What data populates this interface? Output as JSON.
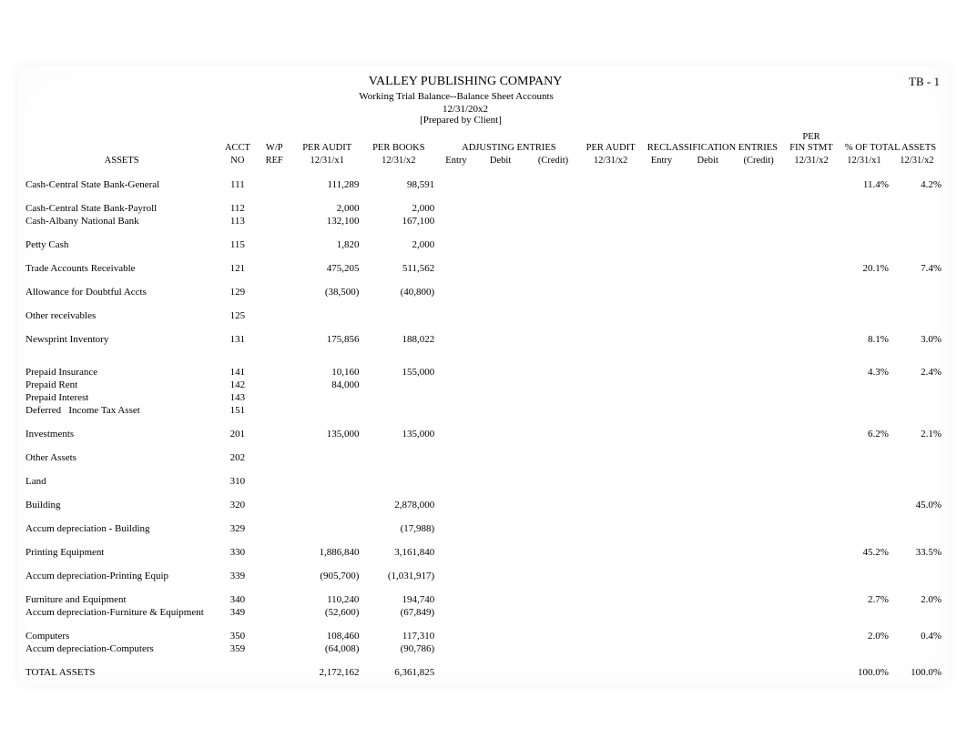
{
  "header": {
    "company": "VALLEY PUBLISHING COMPANY",
    "subtitle": "Working Trial Balance--Balance Sheet Accounts",
    "date": "12/31/20x2",
    "prepared": "[Prepared by Client]",
    "tb": "TB - 1"
  },
  "columns": {
    "assets": "ASSETS",
    "acct_top": "ACCT",
    "acct_bot": "NO",
    "wp_top": "W/P",
    "wp_bot": "REF",
    "pa1_top": "PER AUDIT",
    "pa1_bot": "12/31/x1",
    "pbk_top": "PER BOOKS",
    "pbk_bot": "12/31/x2",
    "adj_top": "ADJUSTING ENTRIES",
    "adj_entry": "Entry",
    "adj_debit": "Debit",
    "adj_credit": "(Credit)",
    "pa2_top": "PER AUDIT",
    "pa2_bot": "12/31/x2",
    "recl_top": "RECLASSIFICATION ENTRIES",
    "recl_entry": "Entry",
    "recl_debit": "Debit",
    "recl_credit": "(Credit)",
    "pfs_top": "PER",
    "pfs_mid": "FIN STMT",
    "pfs_bot": "12/31/x2",
    "pct_top": "% OF TOTAL ASSETS",
    "pct1_bot": "12/31/x1",
    "pct2_bot": "12/31/x2"
  },
  "rows": [
    {
      "name": "Cash-Central State Bank-General",
      "acct": "111",
      "pa1": "111,289",
      "pbk": "98,591",
      "pct1": "11.4%",
      "pct2": "4.2%",
      "spacer_after": true
    },
    {
      "name": "Cash-Central State Bank-Payroll",
      "acct": "112",
      "pa1": "2,000",
      "pbk": "2,000"
    },
    {
      "name": "Cash-Albany National Bank",
      "acct": "113",
      "pa1": "132,100",
      "pbk": "167,100",
      "spacer_after": true
    },
    {
      "name": "Petty Cash",
      "acct": "115",
      "pa1": "1,820",
      "pbk": "2,000",
      "spacer_after": true
    },
    {
      "name": "Trade Accounts Receivable",
      "acct": "121",
      "pa1": "475,205",
      "pbk": "511,562",
      "pct1": "20.1%",
      "pct2": "7.4%",
      "spacer_after": true
    },
    {
      "name": "Allowance for Doubtful Accts",
      "acct": "129",
      "pa1": "(38,500)",
      "pbk": "(40,800)",
      "spacer_after": true
    },
    {
      "name": "Other receivables",
      "acct": "125",
      "spacer_after": true
    },
    {
      "name": "Newsprint Inventory",
      "acct": "131",
      "pa1": "175,856",
      "pbk": "188,022",
      "pct1": "8.1%",
      "pct2": "3.0%",
      "spacer_after": true,
      "tall_spacer": true
    },
    {
      "name": "Prepaid Insurance",
      "acct": "141",
      "pa1": "10,160",
      "pbk": "155,000",
      "pct1": "4.3%",
      "pct2": "2.4%"
    },
    {
      "name": "Prepaid Rent",
      "acct": "142",
      "pa1": "84,000"
    },
    {
      "name": "Prepaid Interest",
      "acct": "143"
    },
    {
      "name": "Deferred   Income Tax Asset",
      "acct": "151",
      "spacer_after": true
    },
    {
      "name": "Investments",
      "acct": "201",
      "pa1": "135,000",
      "pbk": "135,000",
      "pct1": "6.2%",
      "pct2": "2.1%",
      "spacer_after": true
    },
    {
      "name": "Other Assets",
      "acct": "202",
      "spacer_after": true
    },
    {
      "name": "Land",
      "acct": "310",
      "spacer_after": true
    },
    {
      "name": "Building",
      "acct": "320",
      "pbk": "2,878,000",
      "pct2": "45.0%",
      "spacer_after": true
    },
    {
      "name": "Accum depreciation - Building",
      "acct": "329",
      "pbk": "(17,988)",
      "spacer_after": true
    },
    {
      "name": "Printing Equipment",
      "acct": "330",
      "pa1": "1,886,840",
      "pbk": "3,161,840",
      "pct1": "45.2%",
      "pct2": "33.5%",
      "spacer_after": true
    },
    {
      "name": "Accum depreciation-Printing Equip",
      "acct": "339",
      "pa1": "(905,700)",
      "pbk": "(1,031,917)",
      "spacer_after": true
    },
    {
      "name": "Furniture and Equipment",
      "acct": "340",
      "pa1": "110,240",
      "pbk": "194,740",
      "pct1": "2.7%",
      "pct2": "2.0%"
    },
    {
      "name": "Accum depreciation-Furniture & Equipment",
      "acct": "349",
      "pa1": "(52,600)",
      "pbk": "(67,849)",
      "spacer_after": true
    },
    {
      "name": "Computers",
      "acct": "350",
      "pa1": "108,460",
      "pbk": "117,310",
      "pct1": "2.0%",
      "pct2": "0.4%"
    },
    {
      "name": "Accum depreciation-Computers",
      "acct": "359",
      "pa1": "(64,008)",
      "pbk": "(90,786)",
      "spacer_after": true
    },
    {
      "name": "TOTAL ASSETS",
      "pa1": "2,172,162",
      "pbk": "6,361,825",
      "pct1": "100.0%",
      "pct2": "100.0%"
    }
  ]
}
